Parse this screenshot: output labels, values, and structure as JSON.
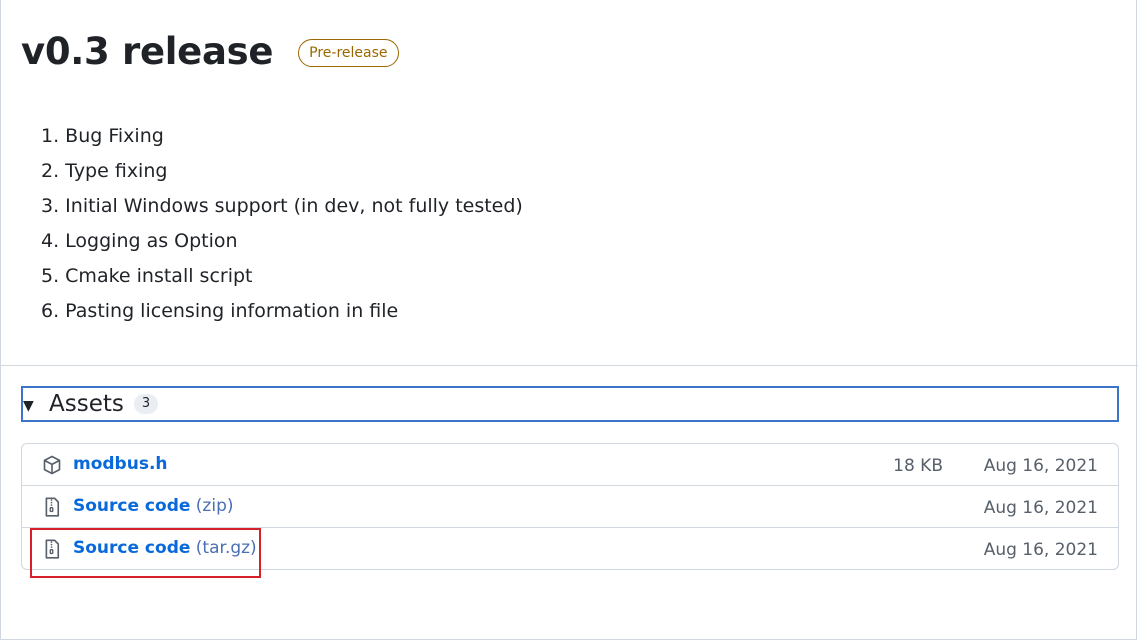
{
  "release": {
    "title": "v0.3 release",
    "badge": "Pre-release"
  },
  "notes": [
    "1. Bug Fixing",
    "2. Type fixing",
    "3. Initial Windows support (in dev, not fully tested)",
    "4. Logging as Option",
    "5. Cmake install script",
    "6. Pasting licensing information in file"
  ],
  "assets": {
    "label": "Assets",
    "count": "3",
    "items": [
      {
        "name": "modbus.h",
        "suffix": "",
        "size": "18 KB",
        "date": "Aug 16, 2021",
        "icon": "package-icon"
      },
      {
        "name": "Source code",
        "suffix": "(zip)",
        "size": "",
        "date": "Aug 16, 2021",
        "icon": "file-zip-icon"
      },
      {
        "name": "Source code",
        "suffix": "(tar.gz)",
        "size": "",
        "date": "Aug 16, 2021",
        "icon": "file-zip-icon"
      }
    ]
  },
  "colors": {
    "link": "#0969da",
    "badge": "#9a6700",
    "highlight": "#d6202a",
    "focus": "#3c74c8"
  }
}
